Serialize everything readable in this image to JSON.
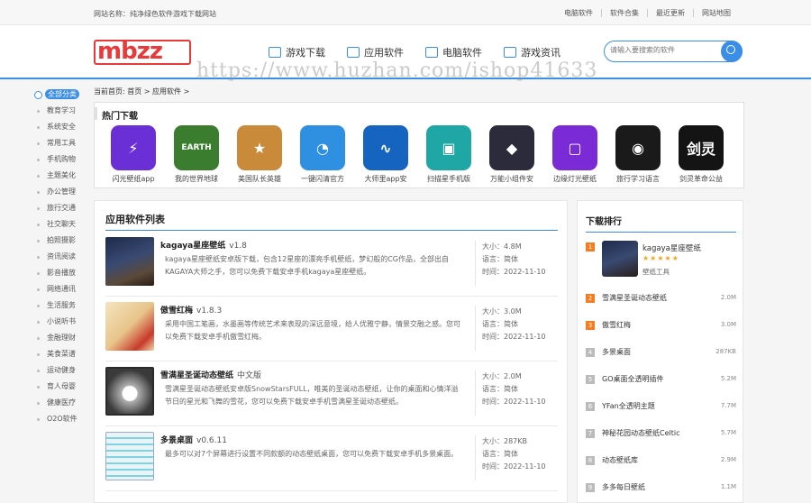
{
  "topbar": {
    "site_name": "网站名称：纯净绿色软件游戏下载网站",
    "links": [
      "电脑软件",
      "软件合集",
      "最近更新",
      "网站地图"
    ]
  },
  "header": {
    "logo": "mbzz",
    "nav": [
      "游戏下载",
      "应用软件",
      "电脑软件",
      "游戏资讯"
    ],
    "search_placeholder": "请输入要搜索的软件"
  },
  "watermark": "https://www.huzhan.com/ishop41633",
  "breadcrumb": "当前首页: 首页 > 应用软件 >",
  "sidebar": {
    "active": "全部分类",
    "items": [
      "教育学习",
      "系统安全",
      "常用工具",
      "手机购物",
      "主题美化",
      "办公管理",
      "旅行交通",
      "社交聊天",
      "拍照摄影",
      "资讯阅读",
      "影音播放",
      "网络通讯",
      "生活服务",
      "小说听书",
      "金融理财",
      "美食菜谱",
      "运动健身",
      "育人母婴",
      "健康医疗",
      "O2O软件"
    ]
  },
  "hot": {
    "title": "热门下载",
    "apps": [
      {
        "name": "闪光壁纸app",
        "color": "#6b2fd6",
        "glyph": "⚡"
      },
      {
        "name": "我的世界地球",
        "color": "#3a7d2e",
        "glyph": "EARTH"
      },
      {
        "name": "美国队长英雄",
        "color": "#c98a3a",
        "glyph": "★"
      },
      {
        "name": "一键闪清官方",
        "color": "#2f8fe0",
        "glyph": "◔"
      },
      {
        "name": "大师里app安",
        "color": "#1565c0",
        "glyph": "∿"
      },
      {
        "name": "扫描星手机版",
        "color": "#1ea7a5",
        "glyph": "▣"
      },
      {
        "name": "万能小组件安",
        "color": "#2b2b3c",
        "glyph": "◆"
      },
      {
        "name": "边缘灯光壁纸",
        "color": "#7a2bd6",
        "glyph": "▢"
      },
      {
        "name": "旅行学习语言",
        "color": "#1a1a1a",
        "glyph": "◉"
      },
      {
        "name": "剑灵革命公益",
        "color": "#141414",
        "glyph": "剑灵"
      }
    ]
  },
  "list": {
    "title": "应用软件列表",
    "size_label": "大小：",
    "lang_label": "语言：",
    "time_label": "时间：",
    "items": [
      {
        "name": "kagaya星座壁纸",
        "ver": "v1.8",
        "desc": "kagaya星座壁纸安卓版下载，包含12星座的漂亮手机壁纸，梦幻般的CG作品，全部出自KAGAYA大师之手，您可以免费下载安卓手机kagaya星座壁纸。",
        "size": "4.8M",
        "lang": "简体",
        "time": "2022-11-10"
      },
      {
        "name": "傲雪红梅",
        "ver": "v1.8.3",
        "desc": "采用中国工笔画，水墨画等传统艺术来表现的深远意境，给人优雅宁静，情景交融之感。您可以免费下载安卓手机傲雪红梅。",
        "size": "3.0M",
        "lang": "简体",
        "time": "2022-11-10"
      },
      {
        "name": "雪满星圣诞动态壁纸",
        "ver": "中文版",
        "desc": "雪满星圣诞动态壁纸安卓版SnowStarsFULL，唯美的圣诞动态壁纸，让你的桌面和心情洋溢节日的星光和飞舞的雪花，您可以免费下载安卓手机雪满星圣诞动态壁纸。",
        "size": "2.0M",
        "lang": "简体",
        "time": "2022-11-10"
      },
      {
        "name": "多景桌面",
        "ver": "v0.6.11",
        "desc": "最多可以对7个屏幕进行设置不同款额的动态壁纸桌面，您可以免费下载安卓手机多景桌面。",
        "size": "287KB",
        "lang": "简体",
        "time": "2022-11-10"
      }
    ]
  },
  "rank": {
    "title": "下载排行",
    "top": {
      "num": "1",
      "name": "kagaya星座壁纸",
      "stars": "★★★★★",
      "cat": "壁纸工具"
    },
    "items": [
      {
        "num": "2",
        "name": "雪满星圣诞动态壁纸",
        "size": "2.0M"
      },
      {
        "num": "3",
        "name": "傲雪红梅",
        "size": "3.0M"
      },
      {
        "num": "4",
        "name": "多景桌面",
        "size": "287KB"
      },
      {
        "num": "5",
        "name": "GO桌面全透明插件",
        "size": "5.2M"
      },
      {
        "num": "6",
        "name": "YFan全透明主题",
        "size": "7.7M"
      },
      {
        "num": "7",
        "name": "神秘花园动态壁纸Celtic",
        "size": "5.7M"
      },
      {
        "num": "8",
        "name": "动态壁纸库",
        "size": "2.9M"
      },
      {
        "num": "9",
        "name": "多多每日壁纸",
        "size": "1.1M"
      }
    ]
  }
}
